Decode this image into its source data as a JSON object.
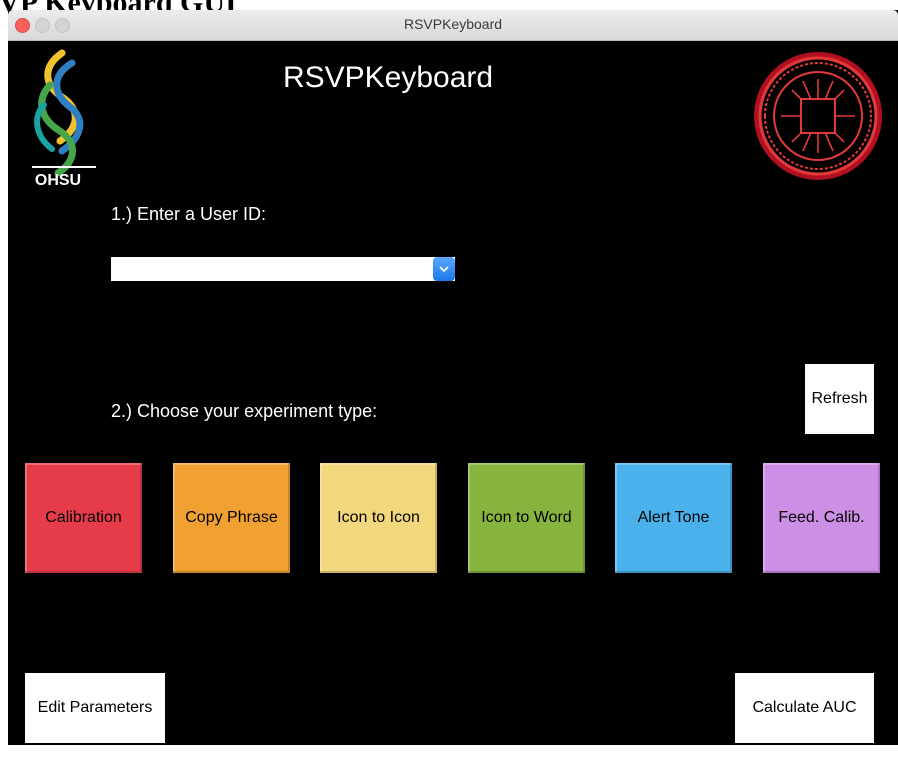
{
  "caption": "RSVP Keyboard GUI",
  "window": {
    "title": "RSVPKeyboard"
  },
  "app": {
    "title": "RSVPKeyboard"
  },
  "logos": {
    "ohsu_text": "OHSU"
  },
  "step1": {
    "label": "1.) Enter a User ID:",
    "user_id_value": ""
  },
  "step2": {
    "label": "2.) Choose your experiment type:"
  },
  "refresh_label": "Refresh",
  "experiments": [
    {
      "label": "Calibration",
      "color": "#e63c4a"
    },
    {
      "label": "Copy Phrase",
      "color": "#f0a132"
    },
    {
      "label": "Icon to Icon",
      "color": "#f3d77c"
    },
    {
      "label": "Icon to Word",
      "color": "#86b43e"
    },
    {
      "label": "Alert Tone",
      "color": "#4ab1ec"
    },
    {
      "label": "Feed. Calib.",
      "color": "#cd8fe6"
    }
  ],
  "bottom": {
    "edit_parameters_label": "Edit Parameters",
    "calculate_auc_label": "Calculate AUC"
  },
  "icons": [
    "ohsu-logo",
    "northeastern-seal",
    "chevron-down-icon"
  ]
}
